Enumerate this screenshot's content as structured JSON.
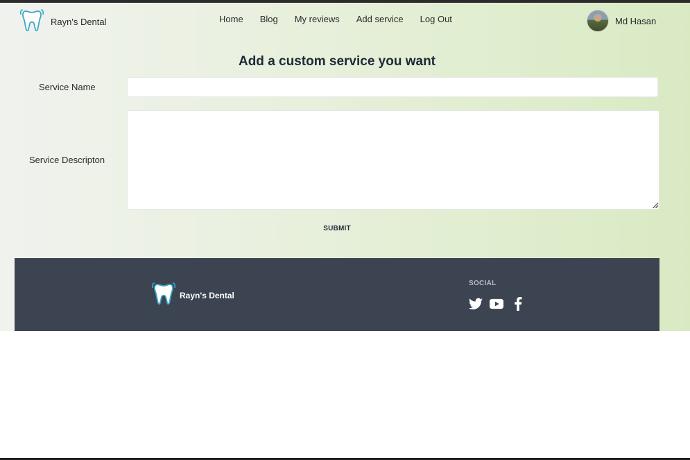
{
  "brand": {
    "name": "Rayn's Dental",
    "icon": "tooth-icon"
  },
  "nav": {
    "items": [
      {
        "label": "Home"
      },
      {
        "label": "Blog"
      },
      {
        "label": "My reviews"
      },
      {
        "label": "Add service"
      },
      {
        "label": "Log Out"
      }
    ]
  },
  "user": {
    "name": "Md Hasan",
    "avatar": "user-avatar-photo"
  },
  "form": {
    "title": "Add a custom service you want",
    "service_name_label": "Service Name",
    "service_name_value": "",
    "service_name_placeholder": "",
    "service_description_label": "Service Descripton",
    "service_description_value": "",
    "submit_label": "SUBMIT"
  },
  "footer": {
    "brand_name": "Rayn's Dental",
    "social_title": "SOCIAL",
    "social_icons": [
      "twitter-icon",
      "youtube-icon",
      "facebook-icon"
    ]
  },
  "colors": {
    "footer_bg": "#3c4451",
    "page_gradient_start": "#f0f2ee",
    "page_gradient_end": "#d9eac3",
    "tooth_outline": "#3aa7c9"
  }
}
